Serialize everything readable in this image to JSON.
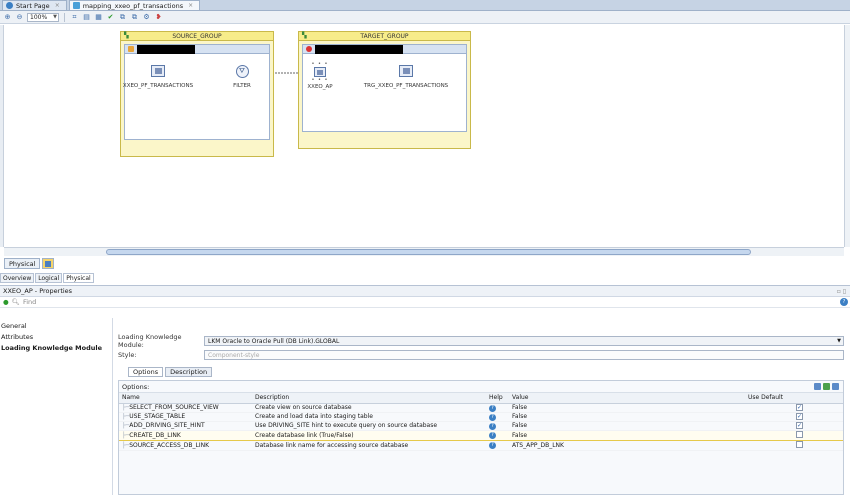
{
  "tabs": [
    {
      "label": "Start Page",
      "icon": "globe-icon"
    },
    {
      "label": "mapping_xxeo_pf_transactions",
      "icon": "mapping-icon"
    }
  ],
  "toolbar": {
    "zoom": "100%"
  },
  "diagram": {
    "source_group": {
      "title": "SOURCE_GROUP",
      "components": [
        {
          "label": "XXEO_PF_TRANSACTIONS",
          "kind": "datastore"
        },
        {
          "label": "FILTER",
          "kind": "filter"
        }
      ]
    },
    "target_group": {
      "title": "TARGET_GROUP",
      "components": [
        {
          "label": "XXEO_AP",
          "kind": "access-point"
        },
        {
          "label": "TRG_XXEO_PF_TRANSACTIONS",
          "kind": "datastore"
        }
      ]
    }
  },
  "view_tabs": {
    "physical": "Physical"
  },
  "sub_tabs": [
    "Overview",
    "Logical",
    "Physical"
  ],
  "properties": {
    "title": "XXEO_AP - Properties",
    "find_placeholder": "Find",
    "nav": [
      "General",
      "Attributes",
      "Loading Knowledge Module"
    ],
    "lkm_label": "Loading Knowledge Module:",
    "lkm_value": "LKM Oracle to Oracle Pull (DB Link).GLOBAL",
    "style_label": "Style:",
    "style_value": "Component-style",
    "inner_tabs": [
      "Options",
      "Description"
    ],
    "options_title": "Options:",
    "columns": [
      "Name",
      "Description",
      "Help",
      "Value",
      "Use Default"
    ],
    "rows": [
      {
        "name": "SELECT_FROM_SOURCE_VIEW",
        "description": "Create view on source database",
        "value": "False",
        "use_default": true
      },
      {
        "name": "USE_STAGE_TABLE",
        "description": "Create and load data into staging table",
        "value": "False",
        "use_default": true
      },
      {
        "name": "ADD_DRIVING_SITE_HINT",
        "description": "Use DRIVING_SITE hint to execute query on source database",
        "value": "False",
        "use_default": true
      },
      {
        "name": "CREATE_DB_LINK",
        "description": "Create database link (True/False)",
        "value": "False",
        "use_default": false
      },
      {
        "name": "SOURCE_ACCESS_DB_LINK",
        "description": "Database link name for accessing source database",
        "value": "ATS_APP_DB_LNK",
        "use_default": false
      }
    ]
  }
}
